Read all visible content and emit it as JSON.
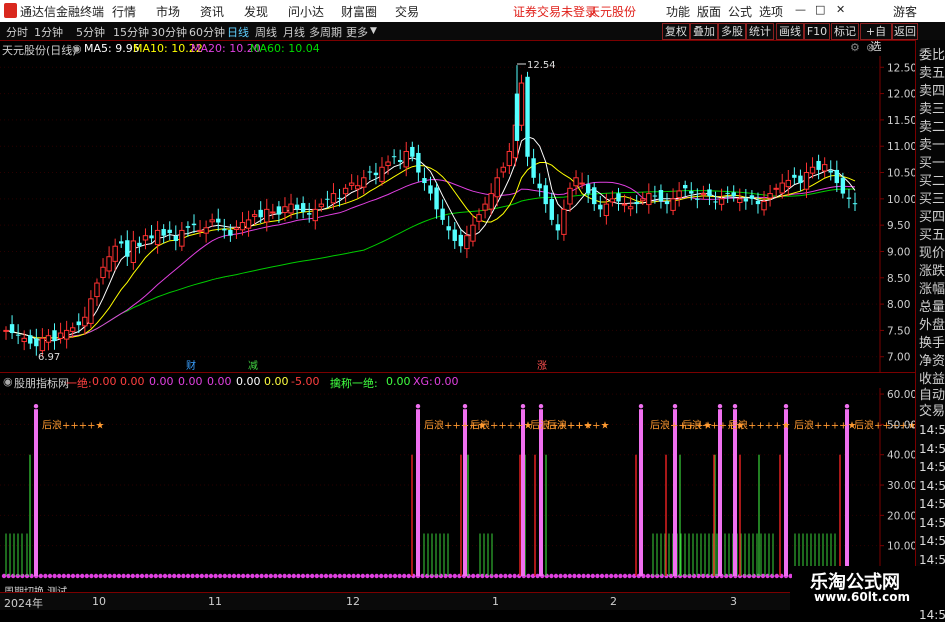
{
  "menubar": {
    "app_title": "通达信金融终端",
    "menus": [
      "行情",
      "市场",
      "资讯",
      "发现",
      "问小达",
      "财富圈",
      "交易"
    ],
    "warning": "证券交易未登录",
    "stock_name": "天元股份",
    "right_menus": [
      "功能",
      "版面",
      "公式",
      "选项"
    ],
    "user": "游客",
    "controls": [
      "—",
      "□",
      "✕"
    ]
  },
  "periods": [
    "分时",
    "1分钟",
    "5分钟",
    "15分钟",
    "30分钟",
    "60分钟",
    "日线",
    "周线",
    "月线",
    "多周期",
    "更多"
  ],
  "selected_period": "日线",
  "toolbar_buttons": [
    "复权",
    "叠加",
    "多股",
    "统计",
    "画线",
    "F10",
    "标记",
    "+自选",
    "返回"
  ],
  "info": {
    "title": "天元股份(日线)",
    "ma5": "MA5: 9.95",
    "ma10": "MA10: 10.22",
    "ma20": "MA20: 10.20",
    "ma60": "MA60: 10.04"
  },
  "price_axis": [
    "12.50",
    "12.00",
    "11.50",
    "11.00",
    "10.50",
    "10.00",
    "9.50",
    "9.00",
    "8.50",
    "8.00",
    "7.50",
    "7.00"
  ],
  "annotations": {
    "high": "12.54",
    "low": "6.97",
    "events": [
      "财",
      "减",
      "涨"
    ]
  },
  "indicator": {
    "title": "股朋指标网",
    "items": [
      {
        "label": "一绝:",
        "value": "0.00",
        "color": "#ff4040"
      },
      {
        "label": "",
        "value": "0.00",
        "color": "#ff4040"
      },
      {
        "label": "",
        "value": "0.00",
        "color": "#e040e0"
      },
      {
        "label": "",
        "value": "0.00",
        "color": "#e040e0"
      },
      {
        "label": "",
        "value": "0.00",
        "color": "#e040e0"
      },
      {
        "label": "",
        "value": "0.00",
        "color": "#ffffff"
      },
      {
        "label": "",
        "value": "0.00",
        "color": "#ffff40"
      },
      {
        "label": "",
        "value": "-5.00",
        "color": "#ff4040"
      },
      {
        "label": "擒称一绝:",
        "value": "0.00",
        "color": "#40ff40"
      },
      {
        "label": "XG:",
        "value": "0.00",
        "color": "#e040e0"
      }
    ],
    "axis": [
      "60.00",
      "50.00",
      "40.00",
      "30.00",
      "20.00",
      "10.00"
    ],
    "signal_text": "后浪++++★"
  },
  "right_panel": [
    "委比",
    "卖五",
    "卖四",
    "卖三",
    "卖二",
    "卖一",
    "买一",
    "买二",
    "买三",
    "买四",
    "买五",
    "现价",
    "涨跌",
    "涨幅",
    "总量",
    "外盘",
    "换手",
    "净资",
    "收益"
  ],
  "right_panel_lower": [
    "自动",
    "交易"
  ],
  "time_ticks": [
    "14:55",
    "14:55",
    "14:55",
    "14:55",
    "14:55",
    "14:56",
    "14:56",
    "14:56",
    "14:56",
    "14:56",
    "14:56"
  ],
  "date_axis": [
    "2024年",
    "10",
    "11",
    "12",
    "1",
    "2",
    "3"
  ],
  "overlay_text": "周期切换 测试",
  "watermark": {
    "line1": "乐淘公式网",
    "line2": "www.60lt.com"
  },
  "colors": {
    "up": "#ff3232",
    "down": "#54ffff",
    "ma5": "#ffffff",
    "ma10": "#ffff00",
    "ma20": "#e040e0",
    "ma60": "#00cc00",
    "border": "#7a0000"
  }
}
